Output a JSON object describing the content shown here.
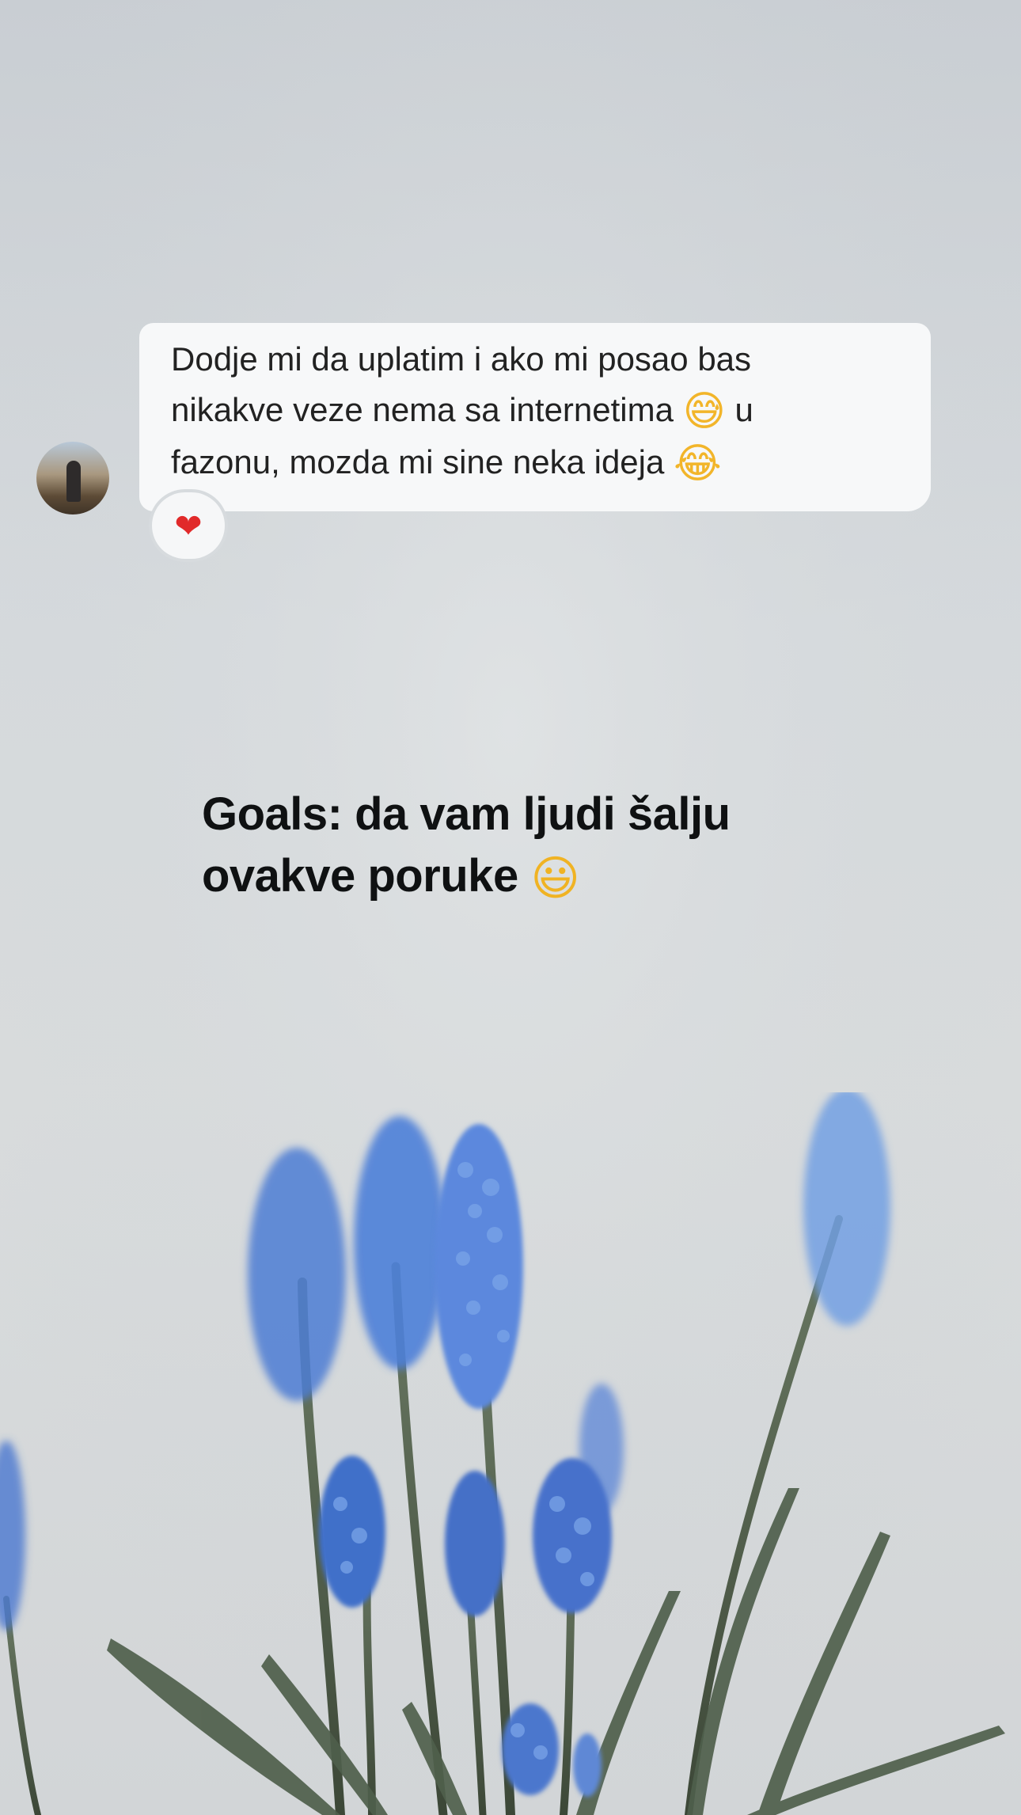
{
  "message": {
    "lines": [
      "Dodje mi da uplatim i ako mi posao bas",
      "nikakve veze nema sa internetima",
      "u",
      "fazonu, mozda mi sine neka ideja"
    ],
    "emojis": {
      "sweat_smile": "😅",
      "tears_of_joy": "😂"
    },
    "reaction": "❤"
  },
  "caption": {
    "line1": "Goals: da vam ljudi šalju",
    "line2": "ovakve poruke",
    "emoji": "😃"
  },
  "colors": {
    "background": "#d6dadd",
    "bubble": "#f7f8f9",
    "caption_text": "#0f1112",
    "heart": "#e12a2a",
    "flower": "#4d78c7",
    "stem": "#51604f"
  }
}
